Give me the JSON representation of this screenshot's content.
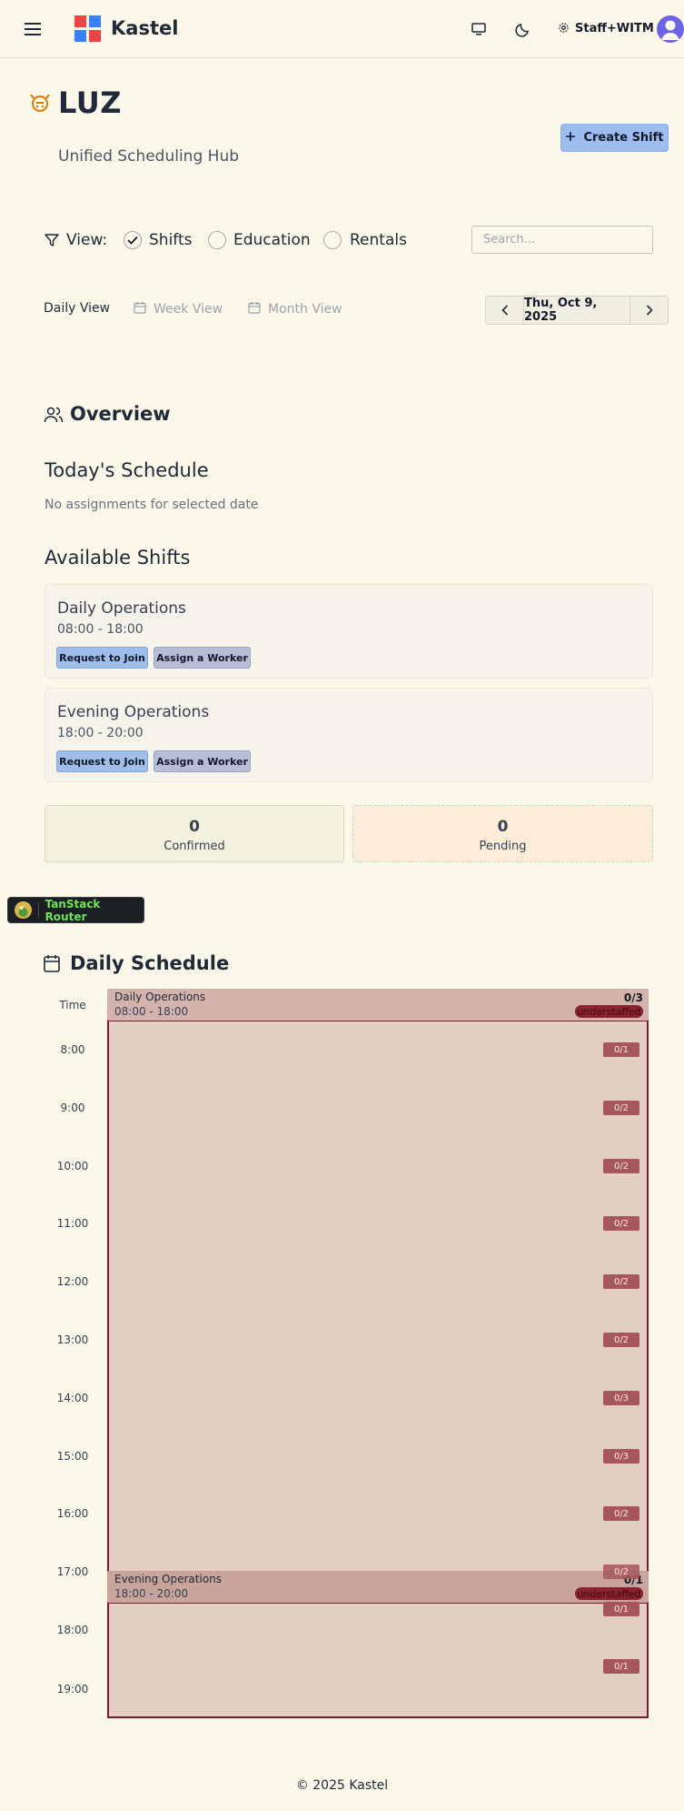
{
  "header": {
    "brand": "Kastel",
    "user_label": "Staff+WITM",
    "icons": [
      "menu-icon",
      "desktop-icon",
      "moon-icon",
      "gear-icon",
      "user-avatar-icon"
    ]
  },
  "page": {
    "title": "LUZ",
    "subtitle": "Unified Scheduling Hub",
    "create_shift_label": "Create Shift"
  },
  "filters": {
    "view_label": "View:",
    "options": [
      {
        "label": "Shifts",
        "checked": true
      },
      {
        "label": "Education",
        "checked": false
      },
      {
        "label": "Rentals",
        "checked": false
      }
    ],
    "search_placeholder": "Search..."
  },
  "view_tabs": {
    "tabs": [
      {
        "label": "Daily View",
        "active": true
      },
      {
        "label": "Week View",
        "active": false
      },
      {
        "label": "Month View",
        "active": false
      }
    ],
    "date_label": "Thu, Oct 9, 2025"
  },
  "overview": {
    "title": "Overview",
    "today_heading": "Today's Schedule",
    "empty_note": "No assignments for selected date",
    "available_heading": "Available Shifts",
    "shifts": [
      {
        "name": "Daily Operations",
        "time": "08:00 - 18:00",
        "request_label": "Request to Join",
        "assign_label": "Assign a Worker"
      },
      {
        "name": "Evening Operations",
        "time": "18:00 - 20:00",
        "request_label": "Request to Join",
        "assign_label": "Assign a Worker"
      }
    ],
    "stats": [
      {
        "value": "0",
        "label": "Confirmed"
      },
      {
        "value": "0",
        "label": "Pending"
      }
    ]
  },
  "devtools": {
    "tanstack_label": "TanStack Router"
  },
  "schedule": {
    "title": "Daily Schedule",
    "time_header": "Time",
    "hours": [
      "8:00",
      "9:00",
      "10:00",
      "11:00",
      "12:00",
      "13:00",
      "14:00",
      "15:00",
      "16:00",
      "17:00",
      "18:00",
      "19:00"
    ],
    "blocks": [
      {
        "name": "Daily Operations",
        "time": "08:00 - 18:00",
        "count": "0/3",
        "status": "understaffed"
      },
      {
        "name": "Evening Operations",
        "time": "18:00 - 20:00",
        "count": "0/1",
        "status": "understaffed"
      }
    ],
    "hour_badges": [
      "0/1",
      "0/2",
      "0/2",
      "0/2",
      "0/2",
      "0/2",
      "0/3",
      "0/3",
      "0/2",
      "0/2",
      "0/1",
      "0/1"
    ]
  },
  "footer": {
    "text": "© 2025 Kastel"
  },
  "colors": {
    "background": "#fbf8ea",
    "accent": "#9dbcef",
    "understaffed": "#8a2231",
    "block_border": "#7a1a28"
  }
}
